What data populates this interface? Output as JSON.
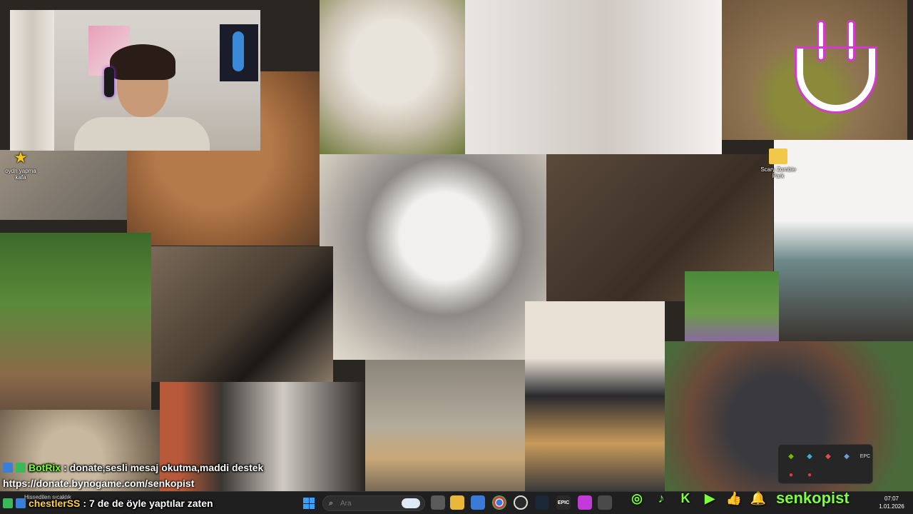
{
  "desktop": {
    "icons": [
      {
        "name": "star-shortcut",
        "label": "oydn yapma\nkafa",
        "icon": "star-icon"
      },
      {
        "name": "folder-shortcut",
        "label": "Scary Zombie\nPark",
        "icon": "folder-icon"
      }
    ],
    "tray_popup_icons": [
      "nvidia-icon",
      "app-icon",
      "shield-icon",
      "steam-icon",
      "epic-icon",
      "record-icon",
      "mic-icon"
    ],
    "tray_popup_labels": [
      "◆",
      "◆",
      "◆",
      "◆",
      "EPC",
      "●",
      "●"
    ]
  },
  "chat": {
    "messages": [
      {
        "user": "BotRix",
        "separator": ":",
        "text": "donate,sesli mesaj okutma,maddi destek",
        "user_color": "#7dff3a"
      },
      {
        "user": "chestlerSS",
        "separator": ":",
        "text": "7 de de öyle yaptılar zaten",
        "user_color": "#ffd23a"
      }
    ],
    "donate_url": "https://donate.bynogame.com/senkopist"
  },
  "taskbar": {
    "weather_text": "Hissedilen sıcaklık",
    "search_placeholder": "Ara",
    "apps": [
      {
        "name": "task-view-icon",
        "label": ""
      },
      {
        "name": "file-explorer-icon",
        "label": ""
      },
      {
        "name": "store-icon",
        "label": ""
      },
      {
        "name": "chrome-icon",
        "label": ""
      },
      {
        "name": "obs-icon",
        "label": ""
      },
      {
        "name": "steam-icon",
        "label": ""
      },
      {
        "name": "epic-games-icon",
        "label": "EPIC"
      },
      {
        "name": "twitch-icon",
        "label": ""
      },
      {
        "name": "app-icon",
        "label": ""
      }
    ],
    "clock_time": "07:07",
    "clock_date": "1.01.2026"
  },
  "social": {
    "icons": [
      "instagram-icon",
      "tiktok-icon",
      "kick-icon",
      "youtube-icon",
      "like-icon",
      "bell-icon"
    ],
    "handle": "senkopist"
  },
  "colors": {
    "accent_green": "#7dff3a",
    "kick_green": "#53fc18",
    "smile_pink": "#d43ad0"
  }
}
